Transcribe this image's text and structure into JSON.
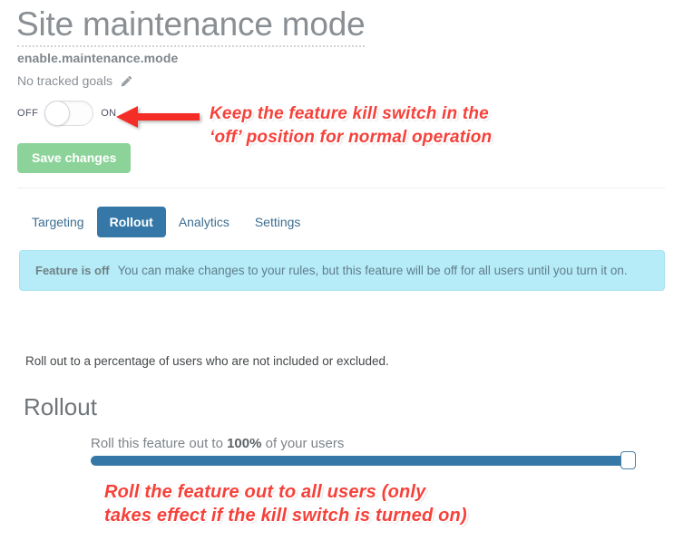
{
  "header": {
    "title": "Site maintenance mode",
    "feature_key": "enable.maintenance.mode",
    "tracked_goals": "No tracked goals",
    "edit_icon": "pencil-icon"
  },
  "kill_switch": {
    "off_label": "OFF",
    "on_label": "ON",
    "state": "off"
  },
  "actions": {
    "save_label": "Save changes",
    "save_color": "#8cd39a"
  },
  "tabs": [
    {
      "label": "Targeting",
      "active": false
    },
    {
      "label": "Rollout",
      "active": true
    },
    {
      "label": "Analytics",
      "active": false
    },
    {
      "label": "Settings",
      "active": false
    }
  ],
  "banner": {
    "strong": "Feature is off",
    "text": "You can make changes to your rules, but this feature will be off for all users until you turn it on.",
    "background": "#b6ecf7"
  },
  "rollout": {
    "description": "Roll out to a percentage of users who are not included or excluded.",
    "heading": "Rollout",
    "label_prefix": "Roll this feature out to ",
    "label_value": "100%",
    "label_suffix": " of your users",
    "percent": 100,
    "slider_color": "#3578a8"
  },
  "annotations": {
    "top": "Keep the feature kill switch in the\n‘off’ position for normal operation",
    "bottom": "Roll the feature out to all users (only\ntakes effect if the kill switch is turned on)",
    "color": "#f6413a",
    "arrow_icon": "left-arrow-icon"
  }
}
